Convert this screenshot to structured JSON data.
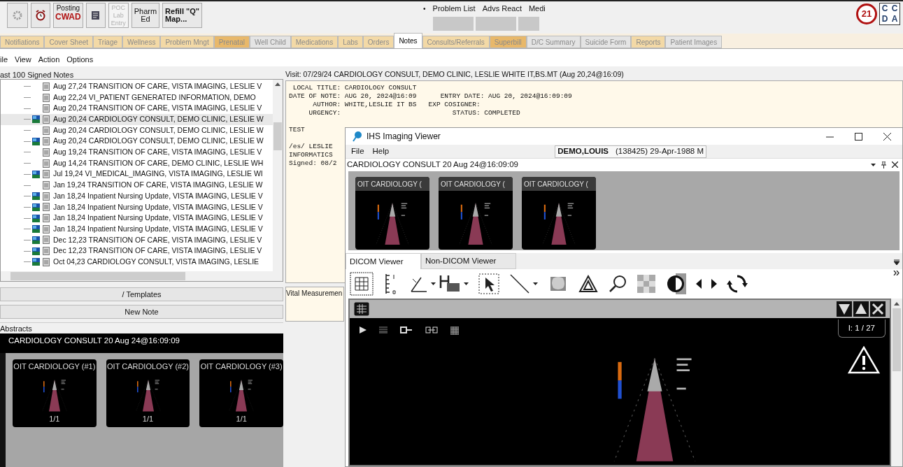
{
  "toolbar": {
    "posting": {
      "top": "Posting",
      "bottom": "CWAD"
    },
    "text_buttons": [
      {
        "lines": [
          "POC",
          "Lab",
          "Entry"
        ],
        "disabled": true
      },
      {
        "lines": [
          "Pharm",
          "Ed"
        ],
        "disabled": false
      },
      {
        "lines": [
          "Refill \"Q\"",
          "Map..."
        ],
        "disabled": false
      }
    ],
    "bullet": "•",
    "links": [
      "Problem List",
      "Advs React",
      "Medi"
    ],
    "logo": {
      "badge": "21",
      "letters": [
        "C",
        "C",
        "D",
        "A"
      ]
    }
  },
  "tabs": [
    {
      "label": "Notifiations",
      "selected": false,
      "color": "#f3d9a6"
    },
    {
      "label": "Cover Sheet",
      "selected": false,
      "color": "#f3d9a6"
    },
    {
      "label": "Triage",
      "selected": false,
      "color": "#f3d9a6"
    },
    {
      "label": "Wellness",
      "selected": false,
      "color": "#f3d9a6"
    },
    {
      "label": "Problem Mngt",
      "selected": false,
      "color": "#f3d9a6"
    },
    {
      "label": "Prenatal",
      "selected": false,
      "color": "#e8b86a"
    },
    {
      "label": "Well Child",
      "selected": false,
      "color": "#e4e4e4"
    },
    {
      "label": "Medications",
      "selected": false,
      "color": "#f3d9a6"
    },
    {
      "label": "Labs",
      "selected": false,
      "color": "#f3d9a6"
    },
    {
      "label": "Orders",
      "selected": false,
      "color": "#f3d9a6"
    },
    {
      "label": "Notes",
      "selected": true,
      "color": "#ffffff"
    },
    {
      "label": "Consults/Referrals",
      "selected": false,
      "color": "#f3d9a6"
    },
    {
      "label": "Superbill",
      "selected": false,
      "color": "#e8b86a"
    },
    {
      "label": "D/C Summary",
      "selected": false,
      "color": "#e4e4e4"
    },
    {
      "label": "Suicide Form",
      "selected": false,
      "color": "#e4e4e4"
    },
    {
      "label": "Reports",
      "selected": false,
      "color": "#f3d9a6"
    },
    {
      "label": "Patient Images",
      "selected": false,
      "color": "#e4e4e4"
    }
  ],
  "menu": [
    "ile",
    "View",
    "Action",
    "Options"
  ],
  "notes_list": {
    "title": "ast 100 Signed Notes",
    "rows": [
      {
        "text": "Aug 27,24  TRANSITION OF CARE, VISTA IMAGING, LESLIE V",
        "has_image": false,
        "selected": false
      },
      {
        "text": "Aug 22,24  VI_PATIENT GENERATED INFORMATION, DEMO",
        "has_image": false,
        "selected": false
      },
      {
        "text": "Aug 20,24  TRANSITION OF CARE, VISTA IMAGING, LESLIE V",
        "has_image": false,
        "selected": false
      },
      {
        "text": "Aug 20,24  CARDIOLOGY CONSULT, DEMO CLINIC, LESLIE W",
        "has_image": true,
        "selected": true
      },
      {
        "text": "Aug 20,24  CARDIOLOGY CONSULT, DEMO CLINIC, LESLIE W",
        "has_image": false,
        "selected": false
      },
      {
        "text": "Aug 20,24  CARDIOLOGY CONSULT, DEMO CLINIC, LESLIE W",
        "has_image": true,
        "selected": false
      },
      {
        "text": "Aug 19,24  TRANSITION OF CARE, VISTA IMAGING, LESLIE V",
        "has_image": false,
        "selected": false
      },
      {
        "text": "Aug 14,24  TRANSITION OF CARE, DEMO CLINIC, LESLIE WH",
        "has_image": false,
        "selected": false
      },
      {
        "text": "Jul 19,24  VI_MEDICAL_IMAGING, VISTA IMAGING, LESLIE WI",
        "has_image": true,
        "selected": false
      },
      {
        "text": "Jan 19,24  TRANSITION OF CARE, VISTA IMAGING, LESLIE W",
        "has_image": false,
        "selected": false
      },
      {
        "text": "Jan 18,24  Inpatient Nursing Update, VISTA IMAGING, LESLIE V",
        "has_image": true,
        "selected": false
      },
      {
        "text": "Jan 18,24  Inpatient Nursing Update, VISTA IMAGING, LESLIE V",
        "has_image": true,
        "selected": false
      },
      {
        "text": "Jan 18,24  Inpatient Nursing Update, VISTA IMAGING, LESLIE V",
        "has_image": true,
        "selected": false
      },
      {
        "text": "Jan 18,24  Inpatient Nursing Update, VISTA IMAGING, LESLIE V",
        "has_image": true,
        "selected": false
      },
      {
        "text": "Dec 12,23  TRANSITION OF CARE, VISTA IMAGING, LESLIE V",
        "has_image": true,
        "selected": false
      },
      {
        "text": "Dec 12,23  TRANSITION OF CARE, VISTA IMAGING, LESLIE V",
        "has_image": true,
        "selected": false
      },
      {
        "text": "Oct 04,23  CARDIOLOGY CONSULT, VISTA IMAGING, LESLIE",
        "has_image": true,
        "selected": false
      }
    ]
  },
  "templates_button": "/ Templates",
  "new_note_button": "New Note",
  "abstracts": {
    "label": "Abstracts",
    "header": "CARDIOLOGY CONSULT  20 Aug 24@16:09:09",
    "thumbnails": [
      {
        "caption": "OIT CARDIOLOGY (#1)",
        "count": "1/1"
      },
      {
        "caption": "OIT CARDIOLOGY (#2)",
        "count": "1/1"
      },
      {
        "caption": "OIT CARDIOLOGY (#3)",
        "count": "1/1"
      }
    ]
  },
  "visit_header": "Visit: 07/29/24  CARDIOLOGY CONSULT, DEMO CLINIC, LESLIE WHITE IT,BS.MT  (Aug 20,24@16:09)",
  "note": {
    "header_lines": [
      " LOCAL TITLE: CARDIOLOGY CONSULT",
      "DATE OF NOTE: AUG 20, 2024@16:09      ENTRY DATE: AUG 20, 2024@16:09:09",
      "      AUTHOR: WHITE,LESLIE IT BS   EXP COSIGNER:",
      "     URGENCY:                            STATUS: COMPLETED"
    ],
    "paragraphs": [
      [
        "TEST"
      ],
      [
        "/es/ LESLIE",
        "INFORMATICS",
        "Signed: 08/2"
      ]
    ]
  },
  "vitals_label": "Vital Measuremen",
  "viewer": {
    "title": "IHS Imaging Viewer",
    "menu": [
      "File",
      "Help"
    ],
    "patient_name": "DEMO,LOUIS",
    "patient_info": "(138425) 29-Apr-1988 M",
    "study_header": "CARDIOLOGY CONSULT  20 Aug 24@16:09:09",
    "thumbnails": [
      "OIT CARDIOLOGY (",
      "OIT CARDIOLOGY (",
      "OIT CARDIOLOGY ("
    ],
    "tabs": [
      {
        "label": "DICOM Viewer",
        "selected": true
      },
      {
        "label": "Non-DICOM Viewer",
        "selected": false
      }
    ],
    "image_counter": "I: 1 / 27"
  }
}
